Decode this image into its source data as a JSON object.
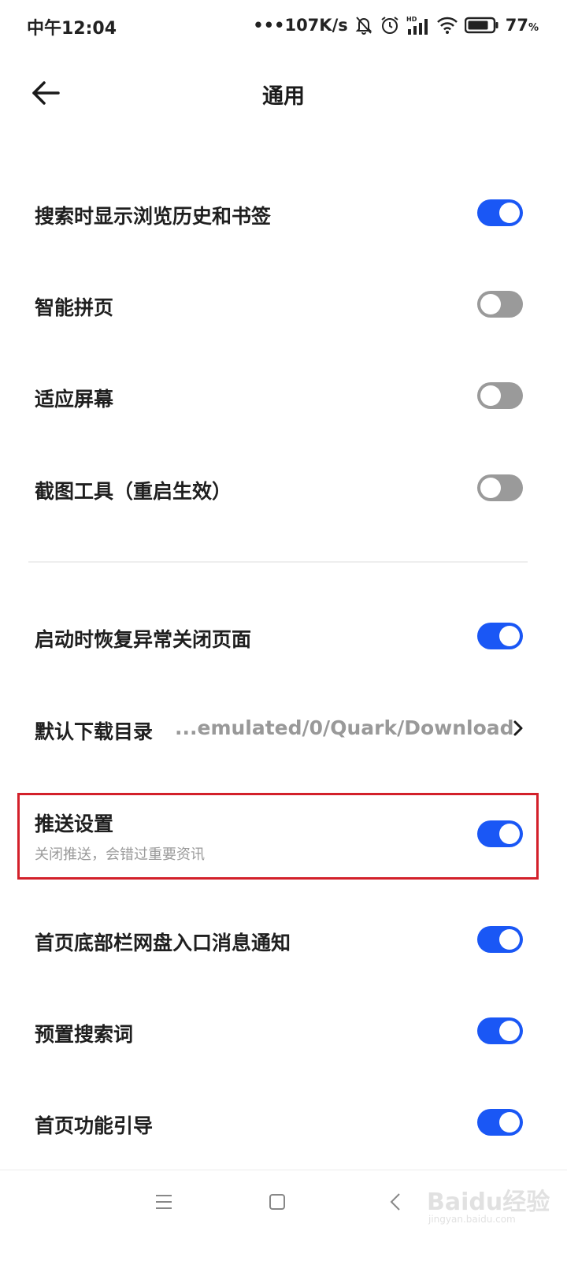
{
  "status_bar": {
    "time": "中午12:04",
    "net_speed": "•••107K/s",
    "battery_pct": "77",
    "battery_unit": "%",
    "icons": [
      "bell-muted-icon",
      "alarm-icon",
      "hd-signal-icon",
      "wifi-icon",
      "battery-icon"
    ]
  },
  "header": {
    "title": "通用",
    "back_icon": "back-arrow-icon"
  },
  "settings": {
    "search_history": {
      "label": "搜索时显示浏览历史和书签",
      "on": true
    },
    "smart_page": {
      "label": "智能拼页",
      "on": false
    },
    "fit_screen": {
      "label": "适应屏幕",
      "on": false
    },
    "screenshot_tool": {
      "label": "截图工具（重启生效）",
      "on": false
    },
    "restore_pages": {
      "label": "启动时恢复异常关闭页面",
      "on": true
    },
    "download_dir": {
      "label": "默认下载目录",
      "value": "...emulated/0/Quark/Download"
    },
    "push": {
      "label": "推送设置",
      "sublabel": "关闭推送，会错过重要资讯",
      "on": true
    },
    "netdisk_notify": {
      "label": "首页底部栏网盘入口消息通知",
      "on": true
    },
    "preset_words": {
      "label": "预置搜索词",
      "on": true
    },
    "feature_guide": {
      "label": "首页功能引导",
      "on": true
    }
  },
  "colors": {
    "accent": "#1a57f5",
    "toggle_off": "#9a9a9a",
    "highlight": "#d3202a"
  },
  "nav_bar": {
    "icons": [
      "menu-icon",
      "home-square-icon",
      "back-chevron-icon"
    ]
  },
  "watermark": {
    "text": "Baidu经验",
    "sub": "jingyan.baidu.com"
  }
}
